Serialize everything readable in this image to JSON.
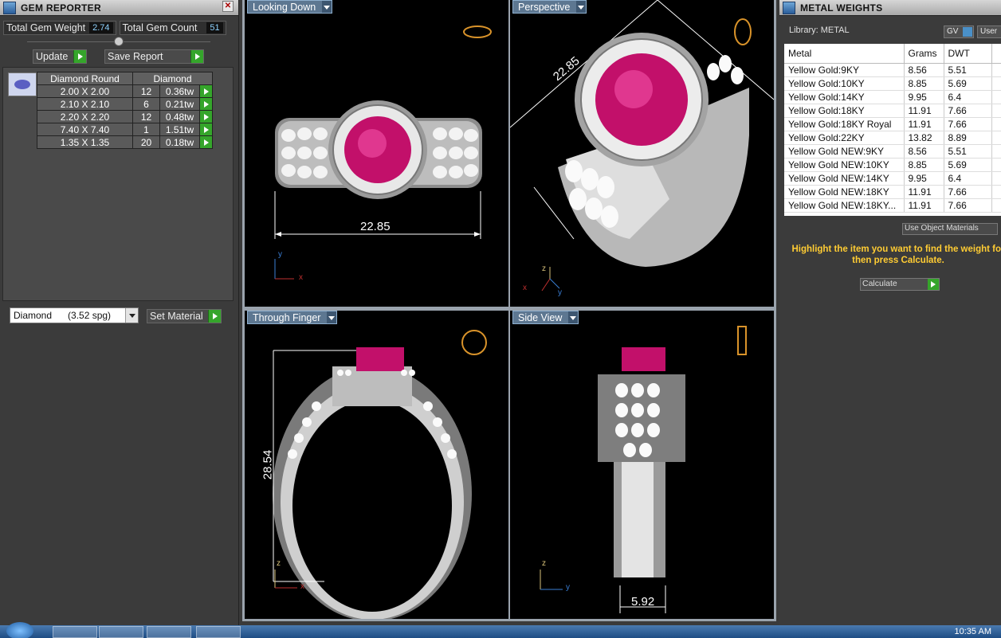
{
  "gem_reporter": {
    "title": "GEM REPORTER",
    "close": "✕",
    "total_weight_label": "Total Gem Weight",
    "total_weight_value": "2.74",
    "total_count_label": "Total Gem Count",
    "total_count_value": "51",
    "update_label": "Update",
    "save_report_label": "Save Report",
    "table": {
      "headers": [
        "Diamond Round",
        "Diamond"
      ],
      "rows": [
        {
          "size": "2.00 X 2.00",
          "count": "12",
          "weight": "0.36tw"
        },
        {
          "size": "2.10 X 2.10",
          "count": "6",
          "weight": "0.21tw"
        },
        {
          "size": "2.20 X 2.20",
          "count": "12",
          "weight": "0.48tw"
        },
        {
          "size": "7.40 X 7.40",
          "count": "1",
          "weight": "1.51tw"
        },
        {
          "size": "1.35 X 1.35",
          "count": "20",
          "weight": "0.18tw"
        }
      ]
    },
    "material_select": "Diamond      (3.52 spg)",
    "set_material_label": "Set Material"
  },
  "viewports": {
    "looking_down": {
      "label": "Looking Down",
      "dimension": "22.85"
    },
    "perspective": {
      "label": "Perspective",
      "dimension": "22.85"
    },
    "through_finger": {
      "label": "Through Finger",
      "dimension": "28.54"
    },
    "side_view": {
      "label": "Side View",
      "dimension": "5.92"
    }
  },
  "metal_weights": {
    "title": "METAL WEIGHTS",
    "library_label": "Library: METAL",
    "gv_label": "GV",
    "user_label": "User",
    "columns": [
      "Metal",
      "Grams",
      "DWT"
    ],
    "rows": [
      {
        "metal": "Yellow Gold:9KY",
        "grams": "8.56",
        "dwt": "5.51"
      },
      {
        "metal": "Yellow Gold:10KY",
        "grams": "8.85",
        "dwt": "5.69"
      },
      {
        "metal": "Yellow Gold:14KY",
        "grams": "9.95",
        "dwt": "6.4"
      },
      {
        "metal": "Yellow Gold:18KY",
        "grams": "11.91",
        "dwt": "7.66"
      },
      {
        "metal": "Yellow Gold:18KY Royal",
        "grams": "11.91",
        "dwt": "7.66"
      },
      {
        "metal": "Yellow Gold:22KY",
        "grams": "13.82",
        "dwt": "8.89"
      },
      {
        "metal": "Yellow Gold NEW:9KY",
        "grams": "8.56",
        "dwt": "5.51"
      },
      {
        "metal": "Yellow Gold NEW:10KY",
        "grams": "8.85",
        "dwt": "5.69"
      },
      {
        "metal": "Yellow Gold NEW:14KY",
        "grams": "9.95",
        "dwt": "6.4"
      },
      {
        "metal": "Yellow Gold NEW:18KY",
        "grams": "11.91",
        "dwt": "7.66"
      },
      {
        "metal": "Yellow Gold NEW:18KY...",
        "grams": "11.91",
        "dwt": "7.66"
      }
    ],
    "use_object_materials": "Use Object Materials",
    "hint": "Highlight the item you want to find the weight for then press Calculate.",
    "calculate_label": "Calculate"
  },
  "taskbar": {
    "clock": "10:35 AM"
  },
  "colors": {
    "ruby": "#c2106a",
    "accent_green": "#35a52b",
    "panel": "#3b3b3b",
    "viewport_label": "#5d7791"
  }
}
